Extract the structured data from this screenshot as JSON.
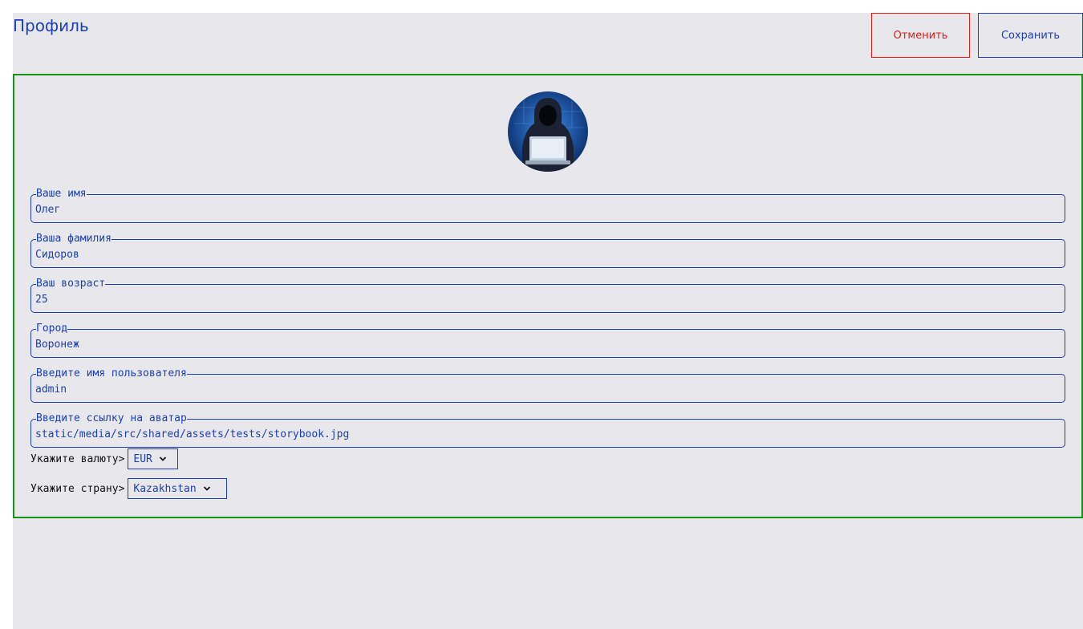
{
  "header": {
    "title": "Профиль",
    "cancel_label": "Отменить",
    "save_label": "Сохранить"
  },
  "avatar": {
    "icon": "hacker-avatar-image"
  },
  "fields": [
    {
      "label": "Ваше имя",
      "value": "Олег"
    },
    {
      "label": "Ваша фамилия",
      "value": "Сидоров"
    },
    {
      "label": "Ваш возраст",
      "value": "25"
    },
    {
      "label": "Город",
      "value": "Воронеж"
    },
    {
      "label": "Введите имя пользователя",
      "value": "admin"
    },
    {
      "label": "Введите ссылку на аватар",
      "value": "static/media/src/shared/assets/tests/storybook.jpg"
    }
  ],
  "currency": {
    "label": "Укажите валюту>",
    "value": "EUR"
  },
  "country": {
    "label": "Укажите страну>",
    "value": "Kazakhstan"
  },
  "colors": {
    "accent": "#1a3fb8",
    "cancel": "#e11a1a",
    "card_border": "#149414",
    "background": "#e8e8ec"
  }
}
